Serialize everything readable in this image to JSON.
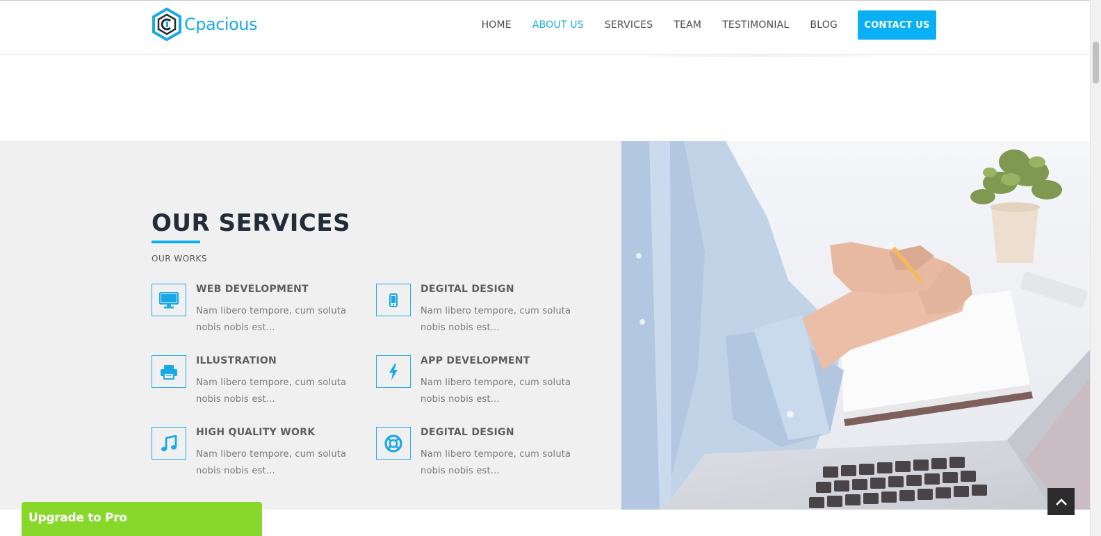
{
  "brand": {
    "name": "Cpacious",
    "logo_icon": "hexagon-c-logo"
  },
  "nav": {
    "items": [
      {
        "label": "HOME",
        "active": false
      },
      {
        "label": "ABOUT US",
        "active": true
      },
      {
        "label": "SERVICES",
        "active": false
      },
      {
        "label": "TEAM",
        "active": false
      },
      {
        "label": "TESTIMONIAL",
        "active": false
      },
      {
        "label": "BLOG",
        "active": false
      }
    ],
    "cta_label": "CONTACT US"
  },
  "services": {
    "title": "OUR SERVICES",
    "subtitle": "OUR WORKS",
    "items": [
      {
        "title": "WEB DEVELOPMENT",
        "desc": "Nam libero tempore, cum soluta nobis nobis est...",
        "icon": "desktop-monitor-icon"
      },
      {
        "title": "DEGITAL DESIGN",
        "desc": "Nam libero tempore, cum soluta nobis nobis est...",
        "icon": "mobile-phone-icon"
      },
      {
        "title": "ILLUSTRATION",
        "desc": "Nam libero tempore, cum soluta nobis nobis est...",
        "icon": "printer-icon"
      },
      {
        "title": "APP DEVELOPMENT",
        "desc": "Nam libero tempore, cum soluta nobis nobis est...",
        "icon": "lightning-bolt-icon"
      },
      {
        "title": "HIGH QUALITY WORK",
        "desc": "Nam libero tempore, cum soluta nobis nobis est...",
        "icon": "music-note-icon"
      },
      {
        "title": "DEGITAL DESIGN",
        "desc": "Nam libero tempore, cum soluta nobis nobis est...",
        "icon": "life-ring-icon"
      }
    ]
  },
  "upgrade_label": "Upgrade to Pro",
  "colors": {
    "accent": "#09b1f4",
    "heading": "#232b38",
    "upgrade": "#87d82b",
    "section_bg": "#f0f0f1"
  }
}
